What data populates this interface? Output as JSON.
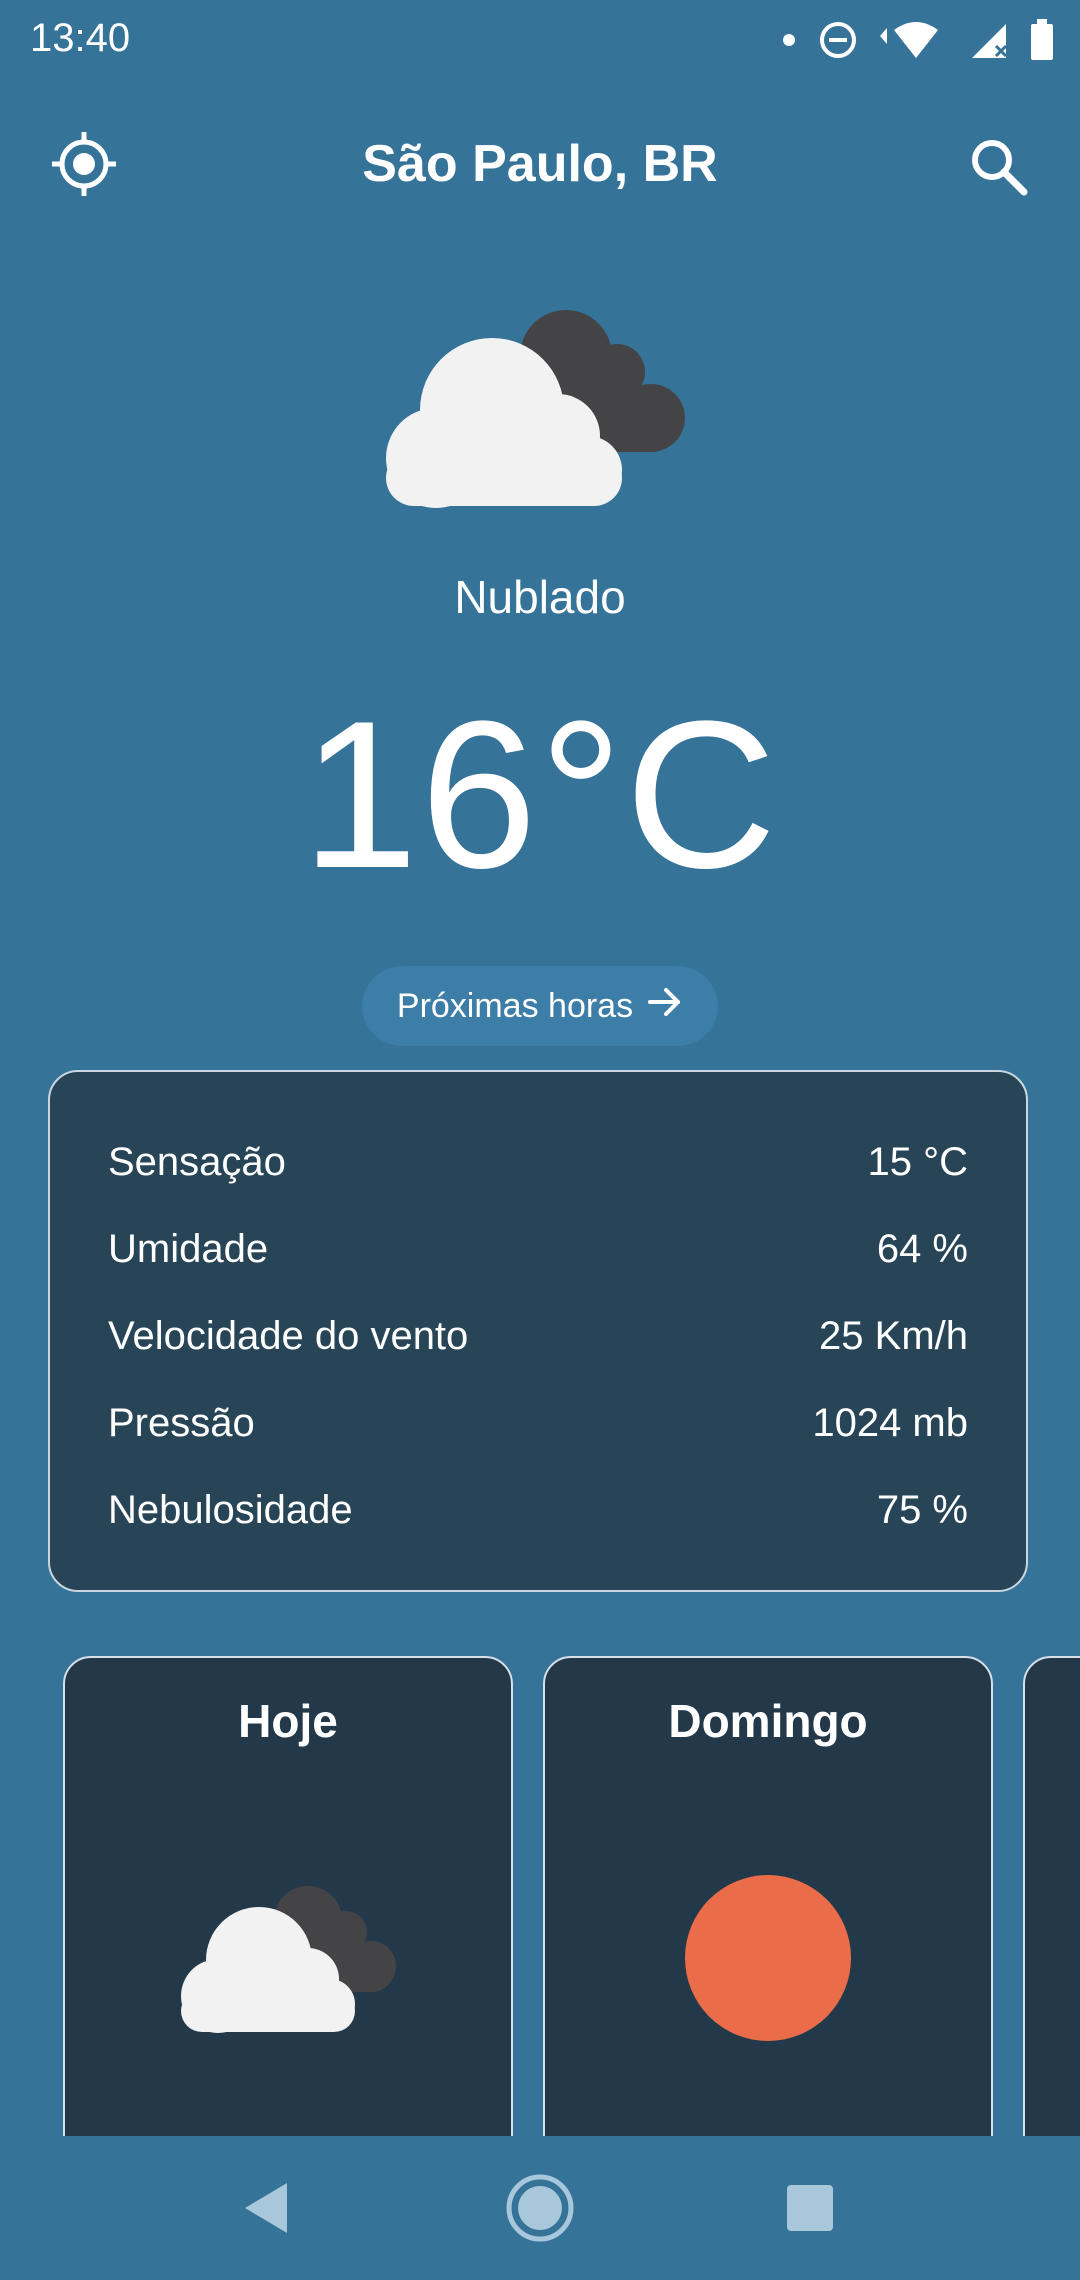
{
  "status_bar": {
    "time": "13:40",
    "icons": [
      "notification-dot-icon",
      "do-not-disturb-icon",
      "wifi-icon",
      "cellular-signal-icon",
      "battery-icon"
    ]
  },
  "header": {
    "location_icon": "crosshair-location-icon",
    "title": "São Paulo, BR",
    "search_icon": "search-icon"
  },
  "current": {
    "icon": "partly-cloudy-icon",
    "condition": "Nublado",
    "temperature": "16°C",
    "next_hours_label": "Próximas horas",
    "next_hours_icon": "arrow-right-icon"
  },
  "details": [
    {
      "label": "Sensação",
      "value": "15 °C"
    },
    {
      "label": "Umidade",
      "value": "64 %"
    },
    {
      "label": "Velocidade do vento",
      "value": "25 Km/h"
    },
    {
      "label": "Pressão",
      "value": "1024 mb"
    },
    {
      "label": "Nebulosidade",
      "value": "75 %"
    }
  ],
  "forecast": [
    {
      "day": "Hoje",
      "icon": "cloudy-icon"
    },
    {
      "day": "Domingo",
      "icon": "sun-icon"
    },
    {
      "day": "",
      "icon": ""
    }
  ],
  "nav_bar": {
    "icons": [
      "back-icon",
      "home-icon",
      "recents-icon"
    ]
  },
  "colors": {
    "background": "#357399",
    "card_background": "#284557",
    "day_card_background": "#23394a",
    "sun": "#ea6c48",
    "cloud_light": "#f2f2f2",
    "cloud_dark": "#444447"
  }
}
